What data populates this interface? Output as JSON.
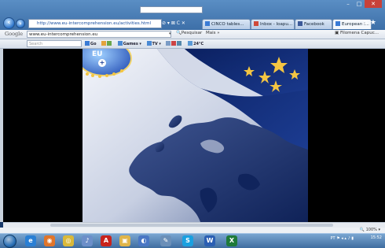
{
  "browser": {
    "address": "http://www.eu-intercomprehension.eu/activities.html",
    "tabs": [
      {
        "label": "CINCO tables...",
        "color": "#3a7bd5"
      },
      {
        "label": "Inbox - Ioapu...",
        "color": "#d04a3a"
      },
      {
        "label": "Facebook",
        "color": "#3b5998"
      },
      {
        "label": "European I...",
        "color": "#3a7bd5"
      }
    ],
    "addr_tools": "⊘ ▾ ⊠ C ✕"
  },
  "google_bar": {
    "label": "Google",
    "field_value": "www.eu-intercomprehension.eu",
    "search_label": "Pesquisar",
    "more_label": "Mais »",
    "user_label": "Filomena Capuc..."
  },
  "addon_bar": {
    "search_placeholder": "Search",
    "items": [
      "Go",
      "Games",
      "TV",
      "24°C"
    ]
  },
  "banner": {
    "logo_text": "EU",
    "logo_plus": "+",
    "accent_blue": "#0d2e78",
    "star_color": "#f4c542"
  },
  "status": {
    "zoom": "100%"
  },
  "taskbar": {
    "icons": [
      {
        "name": "ie-icon",
        "color": "#2a7fd4",
        "glyph": "e"
      },
      {
        "name": "firefox-icon",
        "color": "#e0752b",
        "glyph": "◉"
      },
      {
        "name": "chrome-icon",
        "color": "#d9b93a",
        "glyph": "◎"
      },
      {
        "name": "itunes-icon",
        "color": "#6c8fc9",
        "glyph": "♪"
      },
      {
        "name": "pdf-icon",
        "color": "#c8231c",
        "glyph": "A"
      },
      {
        "name": "folder-icon",
        "color": "#e0b54a",
        "glyph": "▣"
      },
      {
        "name": "app-icon",
        "color": "#4a77c4",
        "glyph": "◐"
      },
      {
        "name": "pinned-icon",
        "color": "#6b8fb8",
        "glyph": "✎"
      },
      {
        "name": "skype-icon",
        "color": "#1aa0e0",
        "glyph": "S"
      },
      {
        "name": "word-icon",
        "color": "#2b5fb3",
        "glyph": "W"
      },
      {
        "name": "excel-icon",
        "color": "#1f7a3a",
        "glyph": "X"
      }
    ],
    "tray_text": "PT",
    "time": "15:52"
  }
}
